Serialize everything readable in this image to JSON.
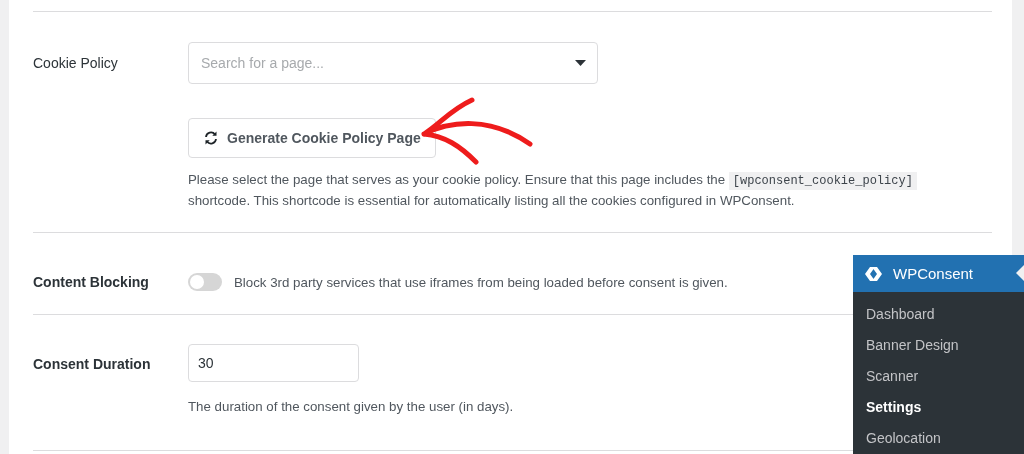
{
  "cookie_policy": {
    "label": "Cookie Policy",
    "select": {
      "placeholder": "Search for a page..."
    },
    "button": "Generate Cookie Policy Page",
    "help": {
      "before": "Please select the page that serves as your cookie policy. Ensure that this page includes the",
      "code": "[wpconsent_cookie_policy]",
      "after": "shortcode. This shortcode is essential for automatically listing all the cookies configured in WPConsent."
    }
  },
  "content_blocking": {
    "label": "Content Blocking",
    "toggle": {
      "on": false
    },
    "description": "Block 3rd party services that use iframes from being loaded before consent is given."
  },
  "consent_duration": {
    "label": "Consent Duration",
    "value": "30",
    "help": "The duration of the consent given by the user (in days)."
  },
  "menu": {
    "title": "WPConsent",
    "items": [
      {
        "label": "Dashboard",
        "selected": false
      },
      {
        "label": "Banner Design",
        "selected": false
      },
      {
        "label": "Scanner",
        "selected": false
      },
      {
        "label": "Settings",
        "selected": true
      },
      {
        "label": "Geolocation",
        "selected": false
      }
    ]
  }
}
